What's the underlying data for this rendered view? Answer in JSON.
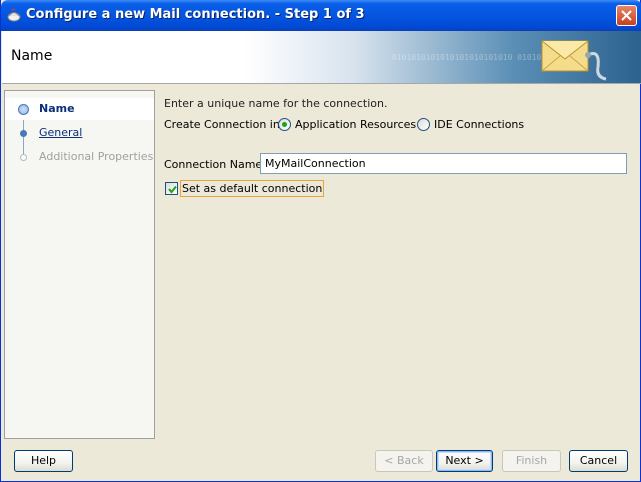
{
  "window": {
    "title": "Configure a new Mail connection. - Step 1 of 3"
  },
  "banner": {
    "title": "Name",
    "decor_binary": "0101010101010101010101010 010101010"
  },
  "nav": {
    "items": [
      {
        "label": "Name",
        "state": "active"
      },
      {
        "label": "General",
        "state": "link"
      },
      {
        "label": "Additional Properties",
        "state": "disabled"
      }
    ]
  },
  "form": {
    "intro": "Enter a unique name for the connection.",
    "create_in_label": "Create Connection in:",
    "create_in_options": [
      {
        "label": "Application Resources",
        "selected": true
      },
      {
        "label": "IDE Connections",
        "selected": false
      }
    ],
    "connection_name_label": "Connection Name:",
    "connection_name_value": "MyMailConnection",
    "default_checkbox_label": "Set as default connection",
    "default_checked": true
  },
  "footer": {
    "help_label": "Help",
    "back_label": "< Back",
    "next_label": "Next >",
    "finish_label": "Finish",
    "cancel_label": "Cancel"
  },
  "colors": {
    "titlebar": "#0456e0",
    "link": "#0b2f7a",
    "focus_border": "#e8a33c"
  }
}
